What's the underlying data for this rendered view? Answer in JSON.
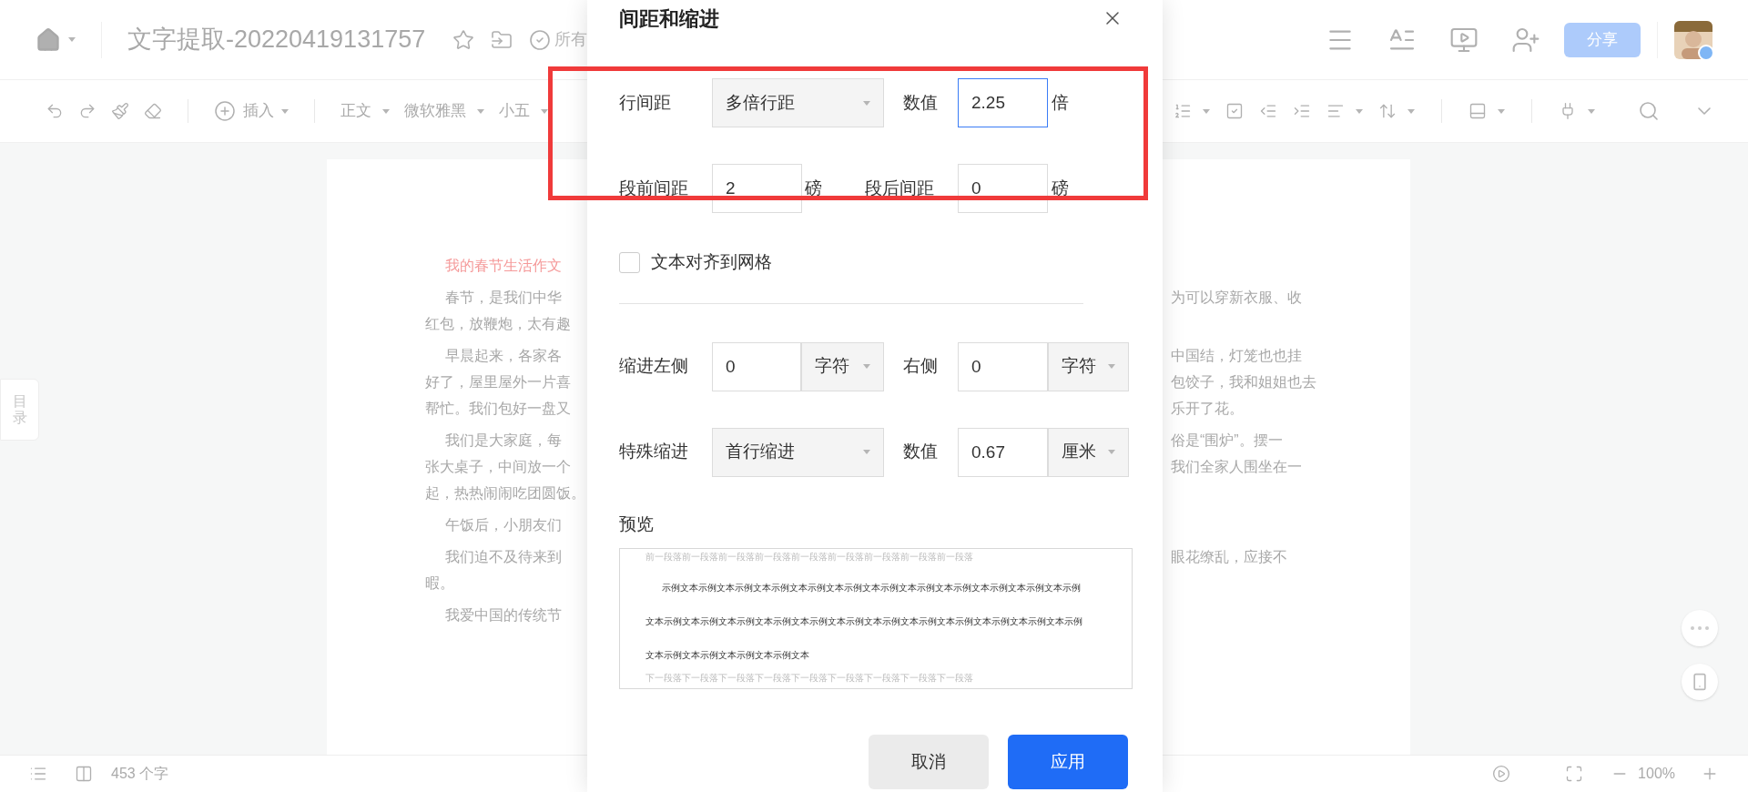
{
  "header": {
    "title": "文字提取-20220419131757",
    "save_status": "所有",
    "share": "分享"
  },
  "toolbar": {
    "insert": "插入",
    "style": "正文",
    "font": "微软雅黑",
    "size": "小五"
  },
  "outline_tab": "目录",
  "document": {
    "paragraphs": [
      {
        "kind": "title",
        "lines": [
          {
            "left": "我的春节生活作文"
          }
        ]
      },
      {
        "kind": "body",
        "lines": [
          {
            "left": "春节，是我们中华",
            "right": "为可以穿新衣服、收"
          },
          {
            "left": "红包，放鞭炮，太有趣"
          }
        ]
      },
      {
        "kind": "body",
        "lines": [
          {
            "left": "早晨起来，各家各",
            "right": "中国结，灯笼也也挂"
          },
          {
            "left": "好了，屋里屋外一片喜",
            "right": "包饺子，我和姐姐也去"
          },
          {
            "left": "帮忙。我们包好一盘又",
            "right": "乐开了花。"
          }
        ]
      },
      {
        "kind": "body",
        "lines": [
          {
            "left": "我们是大家庭，每",
            "right": "俗是“围炉”。摆一"
          },
          {
            "left": "张大桌子，中间放一个",
            "right": "我们全家人围坐在一"
          },
          {
            "left": "起，热热闹闹吃团圆饭。"
          }
        ]
      },
      {
        "kind": "body",
        "lines": [
          {
            "left": "午饭后，小朋友们"
          }
        ]
      },
      {
        "kind": "body",
        "lines": [
          {
            "left": "我们迫不及待来到",
            "right": "眼花缭乱，应接不"
          },
          {
            "left": "暇。"
          }
        ]
      },
      {
        "kind": "body",
        "lines": [
          {
            "left": "我爱中国的传统节"
          }
        ]
      }
    ]
  },
  "dialog": {
    "title": "间距和缩进",
    "line_spacing": {
      "label": "行间距",
      "mode": "多倍行距",
      "value_label": "数值",
      "value": "2.25",
      "unit": "倍",
      "focused": true
    },
    "before": {
      "label": "段前间距",
      "value": "2",
      "unit": "磅"
    },
    "after": {
      "label": "段后间距",
      "value": "0",
      "unit": "磅"
    },
    "snap_to_grid": {
      "label": "文本对齐到网格",
      "checked": false
    },
    "indent_left": {
      "label": "缩进左侧",
      "value": "0",
      "unit": "字符"
    },
    "indent_right": {
      "label": "右侧",
      "value": "0",
      "unit": "字符"
    },
    "special": {
      "label": "特殊缩进",
      "mode": "首行缩进",
      "value_label": "数值",
      "value": "0.67",
      "unit": "厘米"
    },
    "preview": {
      "label": "预览",
      "previous": "前一段落前一段落前一段落前一段落前一段落前一段落前一段落前一段落前一段落",
      "sample_lines": [
        "示例文本示例文本示例文本示例文本示例文本示例文本示例文本示例文本示例文本示例文本示例文本示例",
        "文本示例文本示例文本示例文本示例文本示例文本示例文本示例文本示例文本示例文本示例文本示例文本示例",
        "文本示例文本示例文本示例文本示例文本"
      ],
      "next": "下一段落下一段落下一段落下一段落下一段落下一段落下一段落下一段落下一段落"
    },
    "buttons": [
      {
        "label": "取消",
        "kind": "secondary"
      },
      {
        "label": "应用",
        "kind": "primary"
      }
    ]
  },
  "status_bar": {
    "word_count": "453 个字",
    "zoom": "100%"
  }
}
